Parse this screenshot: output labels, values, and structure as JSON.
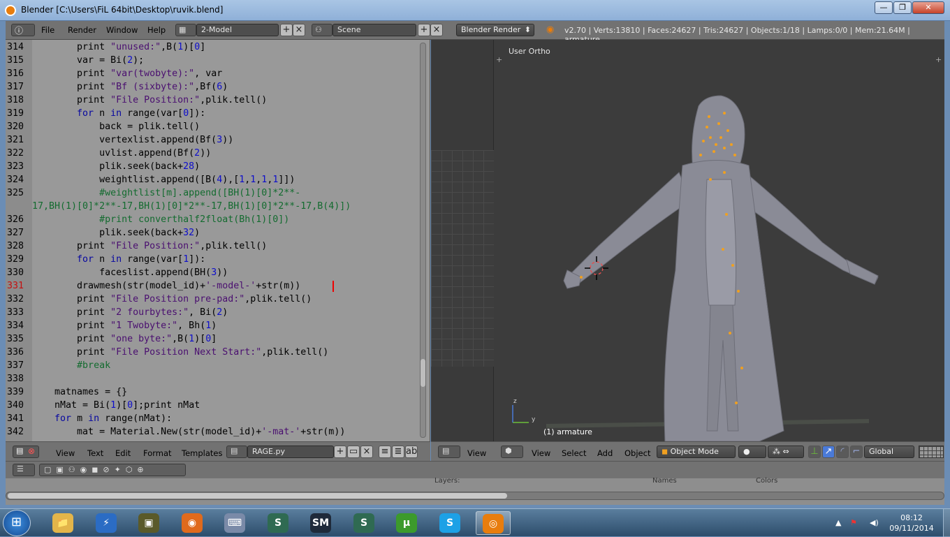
{
  "window": {
    "title": "Blender [C:\\Users\\FiL 64bit\\Desktop\\ruvik.blend]",
    "buttons": [
      "—",
      "❐",
      "✕"
    ]
  },
  "header": {
    "menus": [
      "File",
      "Render",
      "Window",
      "Help"
    ],
    "screen_layout": "2-Model",
    "scene": "Scene",
    "render_engine": "Blender Render",
    "stats": "v2.70 | Verts:13810 | Faces:24627 | Tris:24627 | Objects:1/18 | Lamps:0/0 | Mem:21.64M | armature"
  },
  "text_editor": {
    "current_line": 331,
    "lines": [
      {
        "num": "314",
        "html": "        <span class=b>print</span> <span class=s>\"unused:\"</span>,B(<span class=n>1</span>)[<span class=n>0</span>]"
      },
      {
        "num": "315",
        "html": "        var = Bi(<span class=n>2</span>);"
      },
      {
        "num": "316",
        "html": "        <span class=b>print</span> <span class=s>\"var(twobyte):\"</span>, var"
      },
      {
        "num": "317",
        "html": "        <span class=b>print</span> <span class=s>\"Bf (sixbyte):\"</span>,Bf(<span class=n>6</span>)"
      },
      {
        "num": "318",
        "html": "        <span class=b>print</span> <span class=s>\"File Position:\"</span>,plik.tell()"
      },
      {
        "num": "319",
        "html": "        <span class=k>for</span> n <span class=k>in</span> range(var[<span class=n>0</span>]):"
      },
      {
        "num": "320",
        "html": "            back = plik.tell()"
      },
      {
        "num": "321",
        "html": "            vertexlist.append(Bf(<span class=n>3</span>))"
      },
      {
        "num": "322",
        "html": "            uvlist.append(Bf(<span class=n>2</span>))"
      },
      {
        "num": "323",
        "html": "            plik.seek(back+<span class=n>28</span>)"
      },
      {
        "num": "324",
        "html": "            weightlist.append([B(<span class=n>4</span>),[<span class=n>1</span>,<span class=n>1</span>,<span class=n>1</span>,<span class=n>1</span>]])"
      },
      {
        "num": "325",
        "html": "            <span class=c>#weightlist[m].append([BH(1)[0]*2**-</span>"
      },
      {
        "num": "",
        "html": "<span class=c>17,BH(1)[0]*2**-17,BH(1)[0]*2**-17,BH(1)[0]*2**-17,B(4)])</span>"
      },
      {
        "num": "326",
        "html": "            <span class=c>#print converthalf2float(Bh(1)[0])</span>"
      },
      {
        "num": "327",
        "html": "            plik.seek(back+<span class=n>32</span>)"
      },
      {
        "num": "328",
        "html": "        <span class=b>print</span> <span class=s>\"File Position:\"</span>,plik.tell()"
      },
      {
        "num": "329",
        "html": "        <span class=k>for</span> n <span class=k>in</span> range(var[<span class=n>1</span>]):"
      },
      {
        "num": "330",
        "html": "            faceslist.append(BH(<span class=n>3</span>))"
      },
      {
        "num": "331",
        "html": "        drawmesh(str(model_id)+<span class=s>'-model-'</span>+str(m))"
      },
      {
        "num": "332",
        "html": "        <span class=b>print</span> <span class=s>\"File Position pre-pad:\"</span>,plik.tell()"
      },
      {
        "num": "333",
        "html": "        <span class=b>print</span> <span class=s>\"2 fourbytes:\"</span>, Bi(<span class=n>2</span>)"
      },
      {
        "num": "334",
        "html": "        <span class=b>print</span> <span class=s>\"1 Twobyte:\"</span>, Bh(<span class=n>1</span>)"
      },
      {
        "num": "335",
        "html": "        <span class=b>print</span> <span class=s>\"one byte:\"</span>,B(<span class=n>1</span>)[<span class=n>0</span>]"
      },
      {
        "num": "336",
        "html": "        <span class=b>print</span> <span class=s>\"File Position Next Start:\"</span>,plik.tell()"
      },
      {
        "num": "337",
        "html": "        <span class=c>#break</span>"
      },
      {
        "num": "338",
        "html": ""
      },
      {
        "num": "339",
        "html": "    matnames = {}"
      },
      {
        "num": "340",
        "html": "    nMat = Bi(<span class=n>1</span>)[<span class=n>0</span>];<span class=b>print</span> nMat"
      },
      {
        "num": "341",
        "html": "    <span class=k>for</span> m <span class=k>in</span> range(nMat):"
      },
      {
        "num": "342",
        "html": "        mat = Material.New(str(model_id)+<span class=s>'-mat-'</span>+str(m))"
      }
    ],
    "footer": {
      "menus": [
        "View",
        "Text",
        "Edit",
        "Format",
        "Templates"
      ],
      "filename": "RAGE.py"
    }
  },
  "viewport": {
    "view_label": "User Ortho",
    "object_label": "(1) armature",
    "axis_z": "z",
    "axis_y": "y",
    "footer": {
      "menus": [
        "View",
        "Select",
        "Add",
        "Object"
      ],
      "left_view": "View",
      "mode": "Object Mode",
      "orientation": "Global"
    }
  },
  "properties": {
    "layers_label": "Layers:",
    "names_label": "Names",
    "colors_label": "Colors"
  },
  "taskbar": {
    "apps": [
      {
        "name": "explorer",
        "glyph": "📁",
        "color": "#e3b54a"
      },
      {
        "name": "flash",
        "glyph": "⚡",
        "color": "#2b6cc4"
      },
      {
        "name": "camera",
        "glyph": "▣",
        "color": "#5a5a2a"
      },
      {
        "name": "firefox",
        "glyph": "◉",
        "color": "#e06a1c"
      },
      {
        "name": "keyboard",
        "glyph": "⌨",
        "color": "#7a8aa8"
      },
      {
        "name": "app-s1",
        "glyph": "S",
        "color": "#2f6a52"
      },
      {
        "name": "sm",
        "glyph": "SM",
        "color": "#1f2a3a"
      },
      {
        "name": "app-s2",
        "glyph": "S",
        "color": "#2f6a52"
      },
      {
        "name": "utorrent",
        "glyph": "µ",
        "color": "#3c9a2c"
      },
      {
        "name": "skype",
        "glyph": "S",
        "color": "#1da1e6"
      },
      {
        "name": "blender",
        "glyph": "◎",
        "color": "#e87d0d"
      }
    ],
    "time": "08:12",
    "date": "09/11/2014"
  }
}
